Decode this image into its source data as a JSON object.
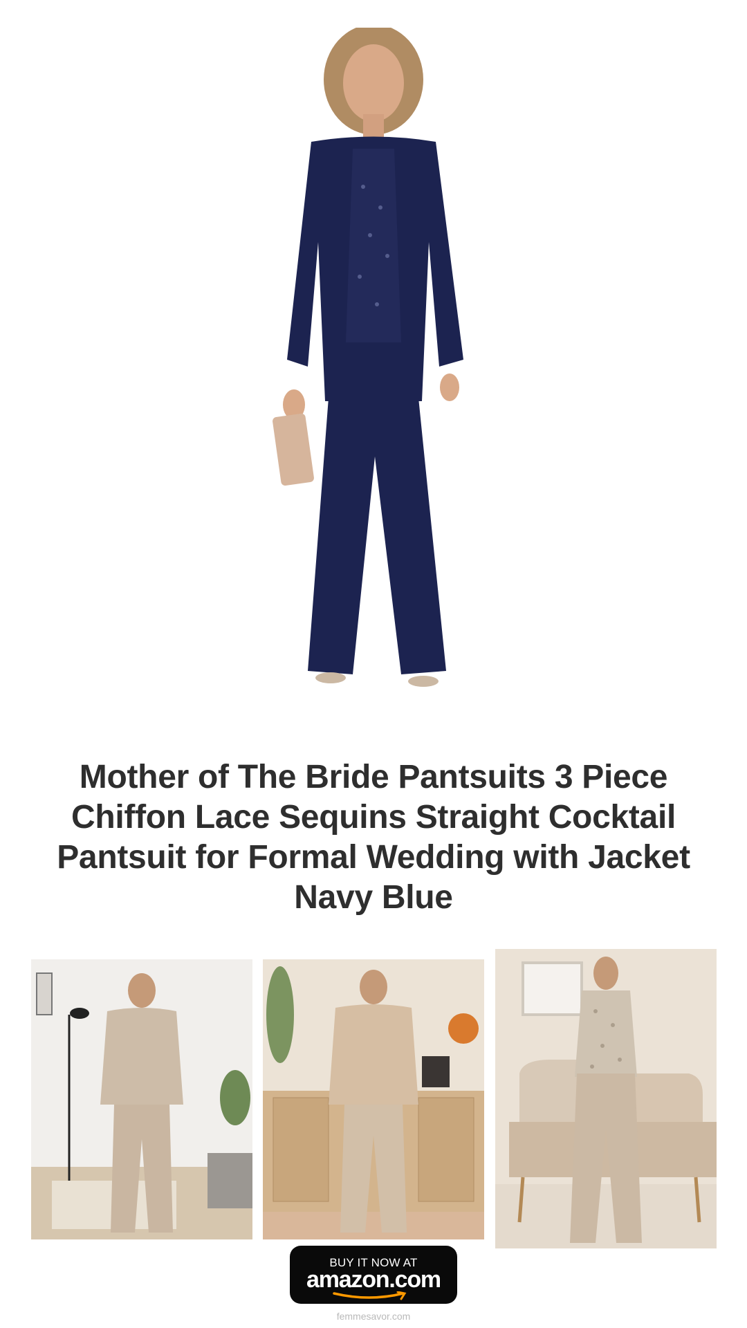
{
  "product": {
    "title": "Mother of The Bride Pantsuits 3 Piece Chiffon Lace Sequins Straight Cocktail Pantsuit for Formal Wedding with Jacket Navy Blue",
    "main_color": "#1c2350"
  },
  "gallery": {
    "thumb_color": "#cdbca8"
  },
  "cta": {
    "top_label": "BUY IT NOW AT",
    "brand_label": "amazon.com",
    "accent_color": "#f90"
  },
  "footer": {
    "site": "femmesavor.com"
  }
}
